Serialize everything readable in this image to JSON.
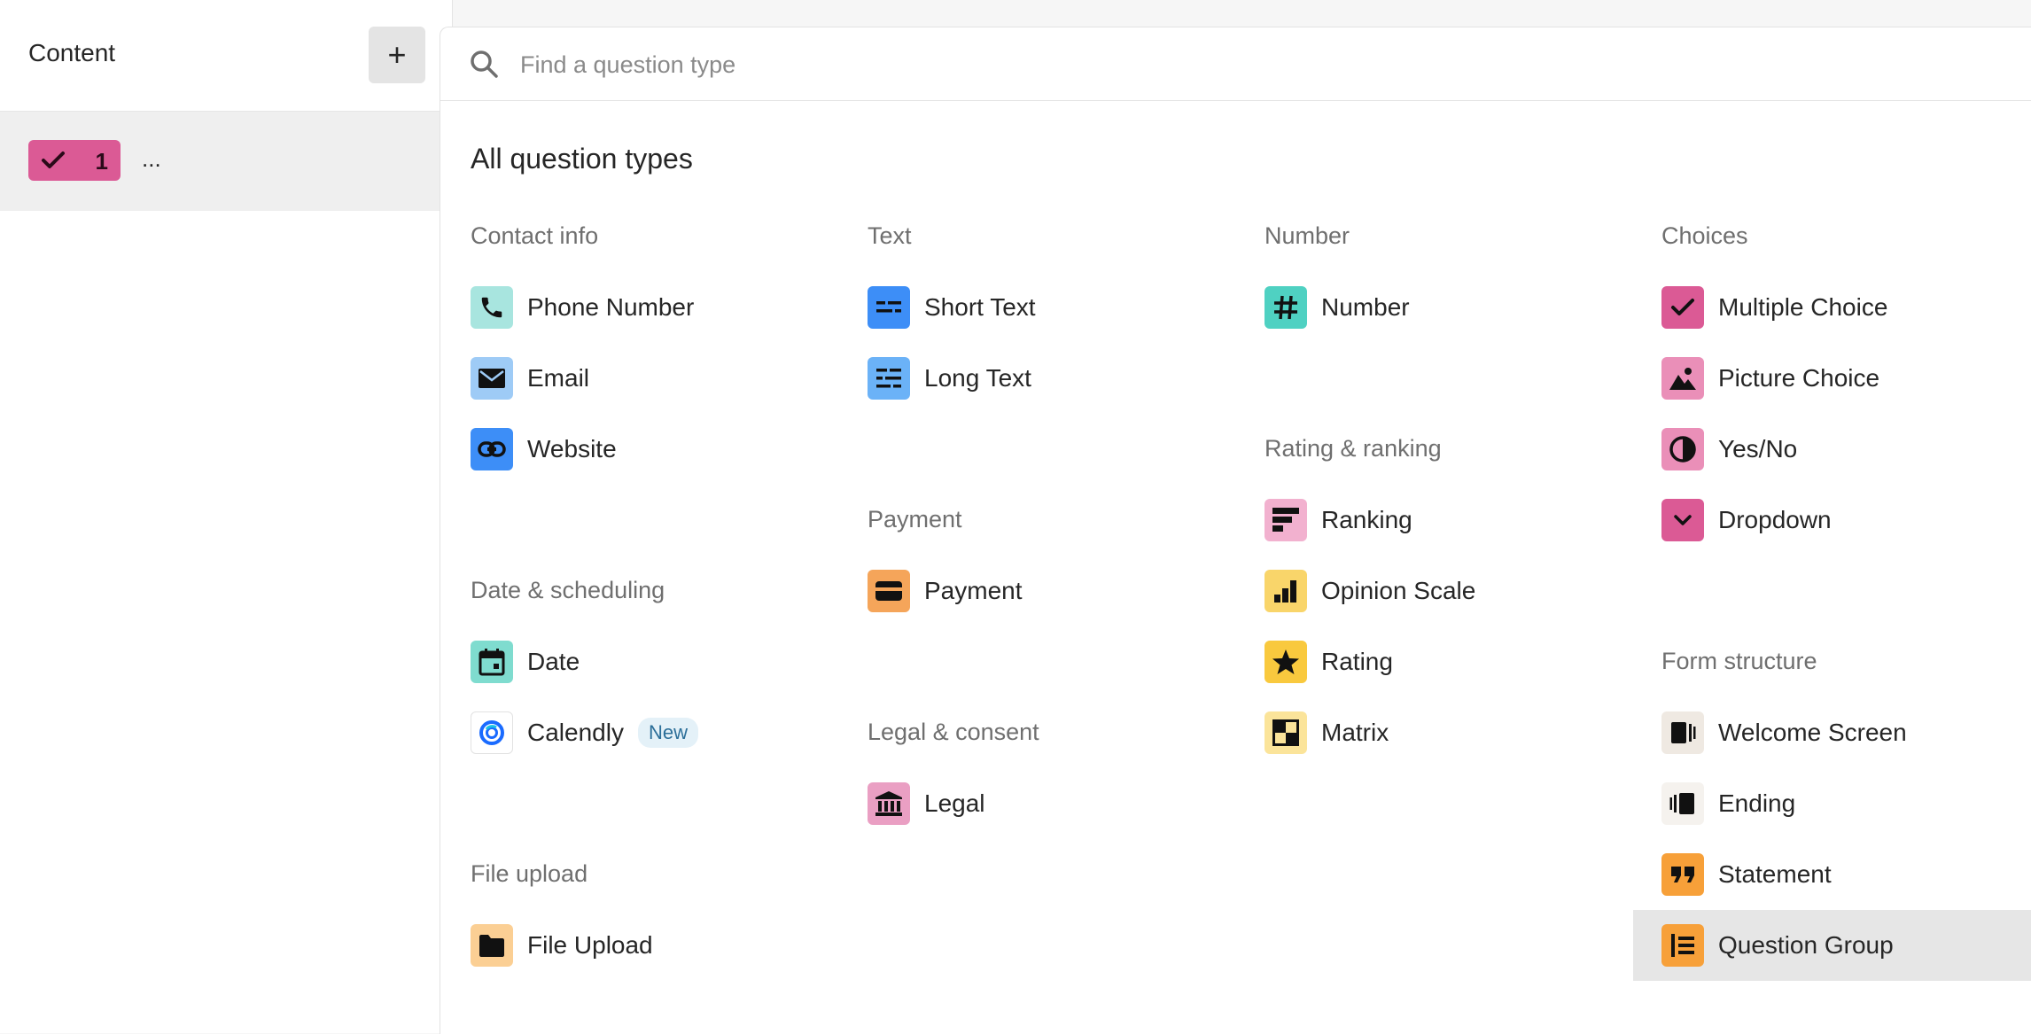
{
  "sidebar": {
    "title": "Content",
    "add_label": "+",
    "question": {
      "number": "1",
      "title": "..."
    }
  },
  "search": {
    "placeholder": "Find a question type"
  },
  "panel": {
    "heading": "All question types",
    "sections": {
      "contact_info": "Contact info",
      "text": "Text",
      "number": "Number",
      "choices": "Choices",
      "payment": "Payment",
      "rating_ranking": "Rating & ranking",
      "date_scheduling": "Date & scheduling",
      "legal_consent": "Legal & consent",
      "form_structure": "Form structure",
      "file_upload": "File upload"
    },
    "types": {
      "phone_number": "Phone Number",
      "email": "Email",
      "website": "Website",
      "short_text": "Short Text",
      "long_text": "Long Text",
      "number": "Number",
      "multiple_choice": "Multiple Choice",
      "picture_choice": "Picture Choice",
      "yes_no": "Yes/No",
      "dropdown": "Dropdown",
      "payment": "Payment",
      "ranking": "Ranking",
      "opinion_scale": "Opinion Scale",
      "rating": "Rating",
      "matrix": "Matrix",
      "date": "Date",
      "calendly": "Calendly",
      "calendly_badge": "New",
      "legal": "Legal",
      "welcome_screen": "Welcome Screen",
      "ending": "Ending",
      "statement": "Statement",
      "question_group": "Question Group",
      "file_upload": "File Upload"
    }
  },
  "colors": {
    "contact": "#a8e5df",
    "blue": "#3d8ef7",
    "light_blue": "#9ecbf6",
    "teal": "#4fd1c2",
    "pink": "#db5a95",
    "light_pink": "#ea8fb8",
    "orange": "#f5a55a",
    "yellow": "#f9d56a",
    "beige": "#efe9e2",
    "orange_strong": "#f7a039"
  }
}
